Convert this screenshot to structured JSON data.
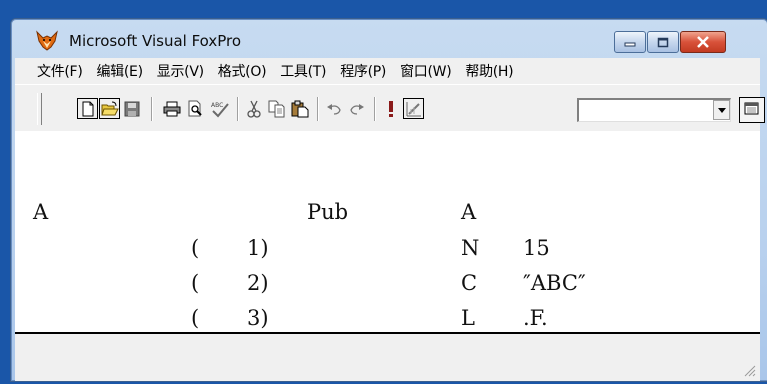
{
  "window": {
    "title": "Microsoft Visual FoxPro",
    "icon": "foxpro-fox-icon",
    "accent": "#1a56a8"
  },
  "menubar": {
    "items": [
      {
        "label": "文件(F)"
      },
      {
        "label": "编辑(E)"
      },
      {
        "label": "显示(V)"
      },
      {
        "label": "格式(O)"
      },
      {
        "label": "工具(T)"
      },
      {
        "label": "程序(P)"
      },
      {
        "label": "窗口(W)"
      },
      {
        "label": "帮助(H)"
      }
    ]
  },
  "toolbar": {
    "buttons": [
      "new-icon",
      "open-icon",
      "save-icon",
      "print-icon",
      "print-preview-icon",
      "spell-check-icon",
      "cut-icon",
      "copy-icon",
      "paste-icon",
      "undo-icon",
      "redo-icon",
      "run-icon",
      "modify-form-icon"
    ],
    "combo_value": ""
  },
  "output": {
    "line1": {
      "c1": "A",
      "c2": "Pub",
      "c3": "A"
    },
    "rows": [
      {
        "paren": "(",
        "index": "1)",
        "type": "N",
        "value": "15"
      },
      {
        "paren": "(",
        "index": "2)",
        "type": "C",
        "value": "″ABC″"
      },
      {
        "paren": "(",
        "index": "3)",
        "type": "L",
        "value": ".F."
      }
    ]
  }
}
